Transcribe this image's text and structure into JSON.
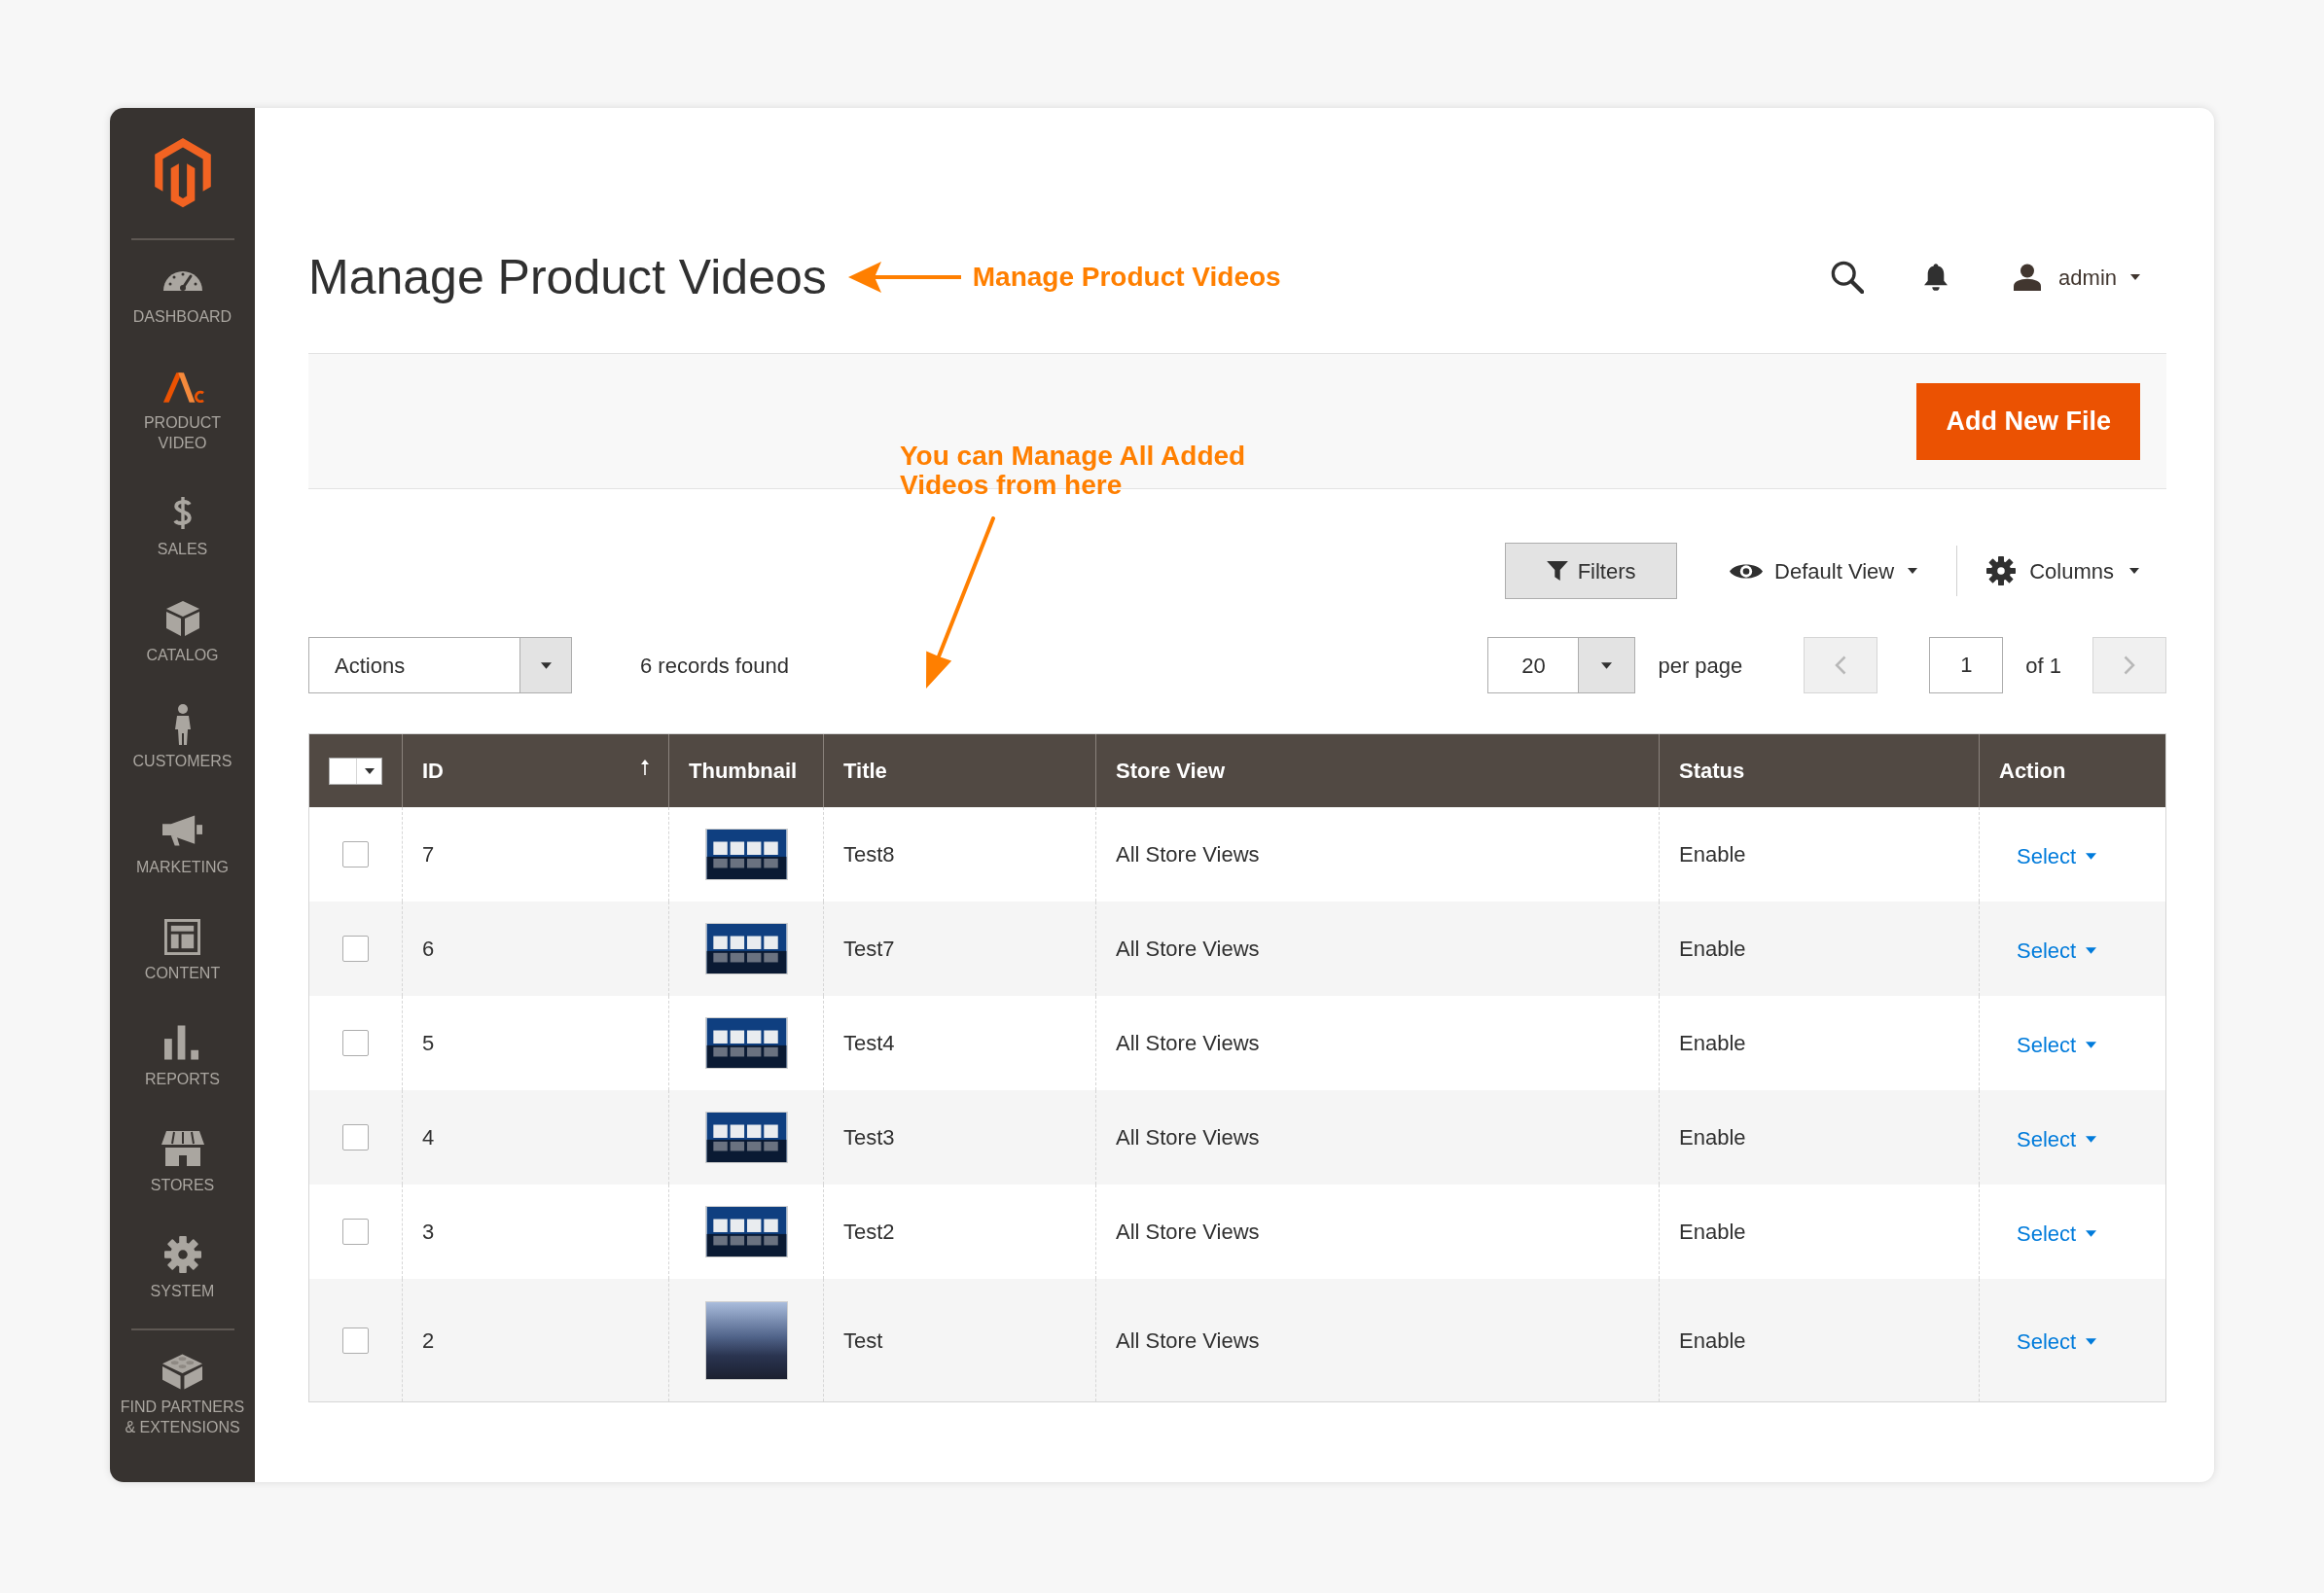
{
  "sidebar": {
    "items": [
      {
        "label": "DASHBOARD",
        "selected": false
      },
      {
        "label": "PRODUCT VIDEO",
        "selected": false
      },
      {
        "label": "SALES",
        "selected": false
      },
      {
        "label": "CATALOG",
        "selected": false
      },
      {
        "label": "CUSTOMERS",
        "selected": false
      },
      {
        "label": "MARKETING",
        "selected": false
      },
      {
        "label": "CONTENT",
        "selected": false
      },
      {
        "label": "REPORTS",
        "selected": false
      },
      {
        "label": "STORES",
        "selected": false
      },
      {
        "label": "SYSTEM",
        "selected": false
      }
    ],
    "footer_items": [
      {
        "label": "FIND PARTNERS & EXTENSIONS",
        "selected": false
      }
    ]
  },
  "header": {
    "title": "Manage Product Videos",
    "user": "admin"
  },
  "title_annotation": {
    "text": "Manage Product Videos"
  },
  "grid_annotation": {
    "text": "You can Manage All Added Videos from here"
  },
  "page_actions": {
    "button": "Add New File"
  },
  "toolbar": {
    "filters": "Filters",
    "view": "Default View",
    "columns": "Columns",
    "actions": "Actions",
    "records": "6 records found",
    "per_page": {
      "value": "20",
      "label": "per page"
    },
    "pager": {
      "page": "1",
      "total": "of 1",
      "prev": {
        "disabled": true
      },
      "next": {
        "disabled": true
      }
    }
  },
  "table": {
    "select_all": {
      "checked": false
    },
    "columns": [
      {
        "label": "ID",
        "sorted": true
      },
      {
        "label": "Thumbnail",
        "sorted": false
      },
      {
        "label": "Title",
        "sorted": false
      },
      {
        "label": "Store View",
        "sorted": false
      },
      {
        "label": "Status",
        "sorted": false
      },
      {
        "label": "Action",
        "sorted": false
      }
    ],
    "rows": [
      {
        "checked": false,
        "id": "7",
        "thumbnail": {
          "kind": "tiles"
        },
        "title": "Test8",
        "store_view": "All Store Views",
        "status": "Enable",
        "action": "Select"
      },
      {
        "checked": false,
        "id": "6",
        "thumbnail": {
          "kind": "tiles"
        },
        "title": "Test7",
        "store_view": "All Store Views",
        "status": "Enable",
        "action": "Select"
      },
      {
        "checked": false,
        "id": "5",
        "thumbnail": {
          "kind": "tiles"
        },
        "title": "Test4",
        "store_view": "All Store Views",
        "status": "Enable",
        "action": "Select"
      },
      {
        "checked": false,
        "id": "4",
        "thumbnail": {
          "kind": "tiles"
        },
        "title": "Test3",
        "store_view": "All Store Views",
        "status": "Enable",
        "action": "Select"
      },
      {
        "checked": false,
        "id": "3",
        "thumbnail": {
          "kind": "tiles"
        },
        "title": "Test2",
        "store_view": "All Store Views",
        "status": "Enable",
        "action": "Select"
      },
      {
        "checked": false,
        "id": "2",
        "thumbnail": {
          "kind": "photo"
        },
        "title": "Test",
        "store_view": "All Store Views",
        "status": "Enable",
        "action": "Select"
      }
    ]
  }
}
